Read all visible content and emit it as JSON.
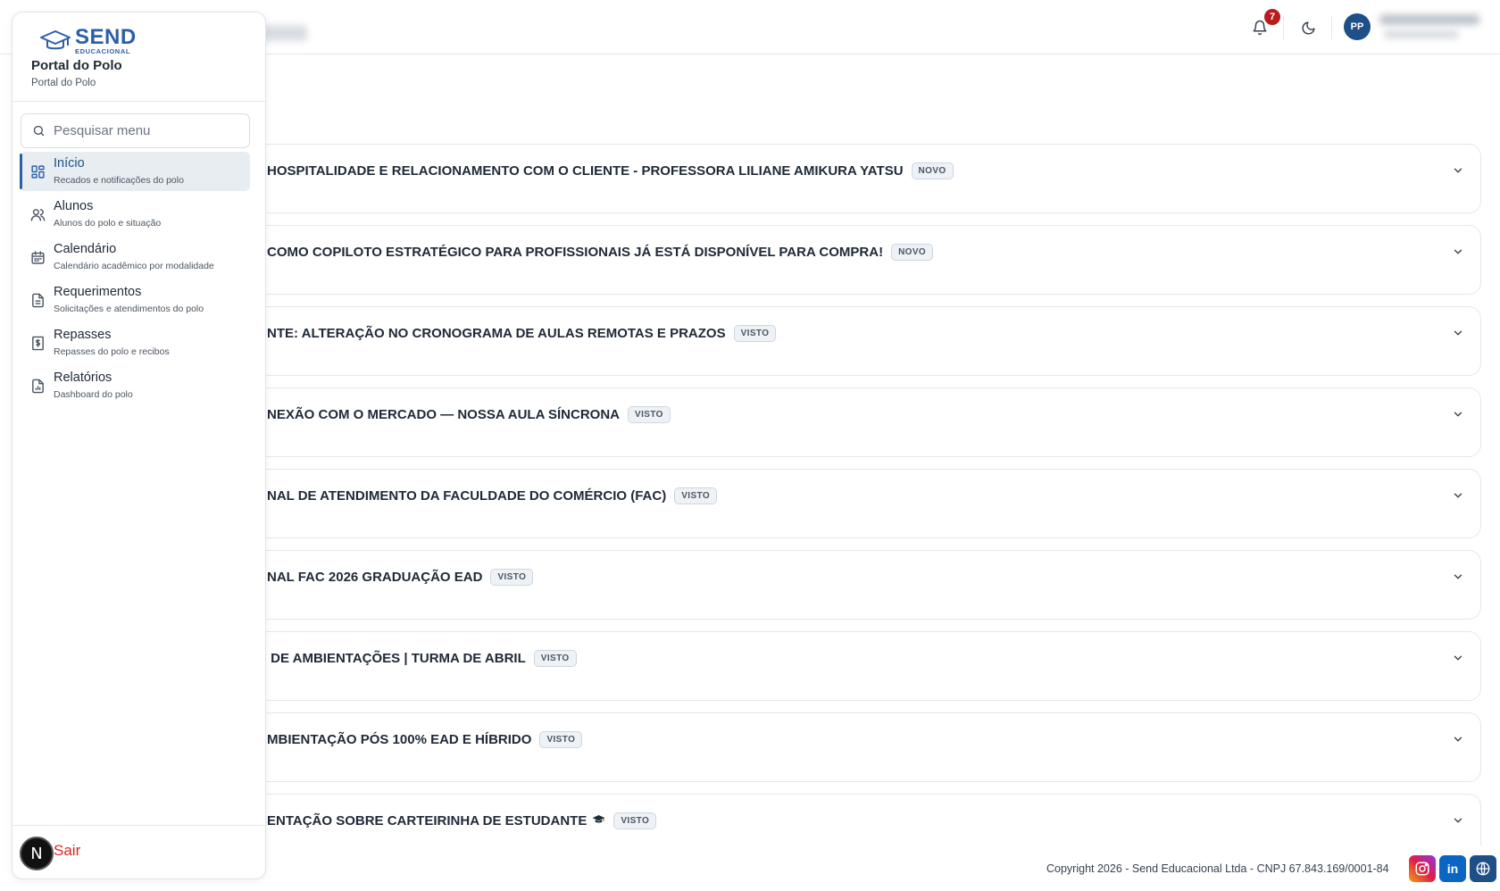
{
  "header": {
    "notification_count": "7",
    "user_initials": "PP"
  },
  "announcements": [
    {
      "title": "HOSPITALIDADE E RELACIONAMENTO COM O CLIENTE - PROFESSORA LILIANE AMIKURA YATSU",
      "status": "NOVO"
    },
    {
      "title": "COMO COPILOTO ESTRATÉGICO PARA PROFISSIONAIS JÁ ESTÁ DISPONÍVEL PARA COMPRA!",
      "status": "NOVO"
    },
    {
      "title": "NTE: ALTERAÇÃO NO CRONOGRAMA DE AULAS REMOTAS E PRAZOS",
      "status": "VISTO"
    },
    {
      "title": "NEXÃO COM O MERCADO — NOSSA AULA SÍNCRONA",
      "status": "VISTO"
    },
    {
      "title": "NAL DE ATENDIMENTO DA FACULDADE DO COMÉRCIO (FAC)",
      "status": "VISTO"
    },
    {
      "title": "NAL FAC 2026 GRADUAÇÃO EAD",
      "status": "VISTO"
    },
    {
      "title": " DE AMBIENTAÇÕES | TURMA DE ABRIL",
      "status": "VISTO"
    },
    {
      "title": "MBIENTAÇÃO PÓS 100% EAD E HÍBRIDO",
      "status": "VISTO"
    },
    {
      "title": "ENTAÇÃO SOBRE CARTEIRINHA DE ESTUDANTE",
      "status": "VISTO",
      "icon": "graduation-cap-icon"
    }
  ],
  "footer": {
    "copyright": "Copyright 2026 - Send Educacional Ltda - CNPJ 67.843.169/0001-84",
    "linkedin_label": "in"
  },
  "sidebar": {
    "logo_text": "SEND",
    "logo_sub": "EDUCACIONAL",
    "title": "Portal do Polo",
    "subtitle": "Portal do Polo",
    "search_placeholder": "Pesquisar menu",
    "items": [
      {
        "label": "Início",
        "sub": "Recados e notificações do polo",
        "icon": "dashboard-icon"
      },
      {
        "label": "Alunos",
        "sub": "Alunos do polo e situação",
        "icon": "users-icon"
      },
      {
        "label": "Calendário",
        "sub": "Calendário acadêmico por modalidade",
        "icon": "calendar-icon"
      },
      {
        "label": "Requerimentos",
        "sub": "Solicitações e atendimentos do polo",
        "icon": "document-icon"
      },
      {
        "label": "Repasses",
        "sub": "Repasses do polo e recibos",
        "icon": "receipt-icon"
      },
      {
        "label": "Relatórios",
        "sub": "Dashboard do polo",
        "icon": "report-icon"
      }
    ],
    "logout_label": "Sair",
    "dev_badge": "N"
  },
  "colors": {
    "brand": "#2b5fa8",
    "avatar": "#1e4f86",
    "badge": "#b91c1c",
    "logout": "#dc2626"
  }
}
